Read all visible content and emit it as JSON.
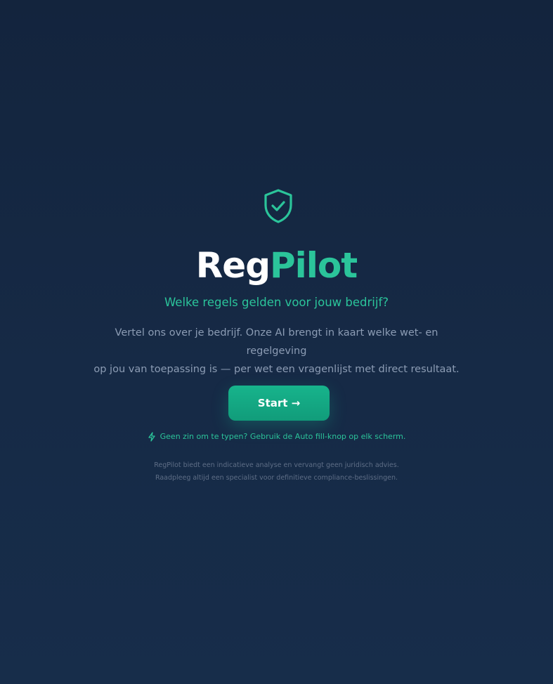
{
  "brand": {
    "name_part1": "Reg",
    "name_part2": "Pilot",
    "logo_icon": "shield-check-icon",
    "accent_color": "#2bc49a"
  },
  "hero": {
    "tagline": "Welke regels gelden voor jouw bedrijf?",
    "description_line1": "Vertel ons over je bedrijf. Onze AI brengt in kaart welke wet- en regelgeving",
    "description_line2": "op jou van toepassing is — per wet een vragenlijst met direct resultaat."
  },
  "cta": {
    "start_label": "Start →"
  },
  "hint": {
    "icon": "lightning-icon",
    "text": "Geen zin om te typen? Gebruik de Auto fill-knop op elk scherm."
  },
  "disclaimer": {
    "line1": "RegPilot biedt een indicatieve analyse en vervangt geen juridisch advies.",
    "line2": "Raadpleeg altijd een specialist voor definitieve compliance-beslissingen."
  }
}
